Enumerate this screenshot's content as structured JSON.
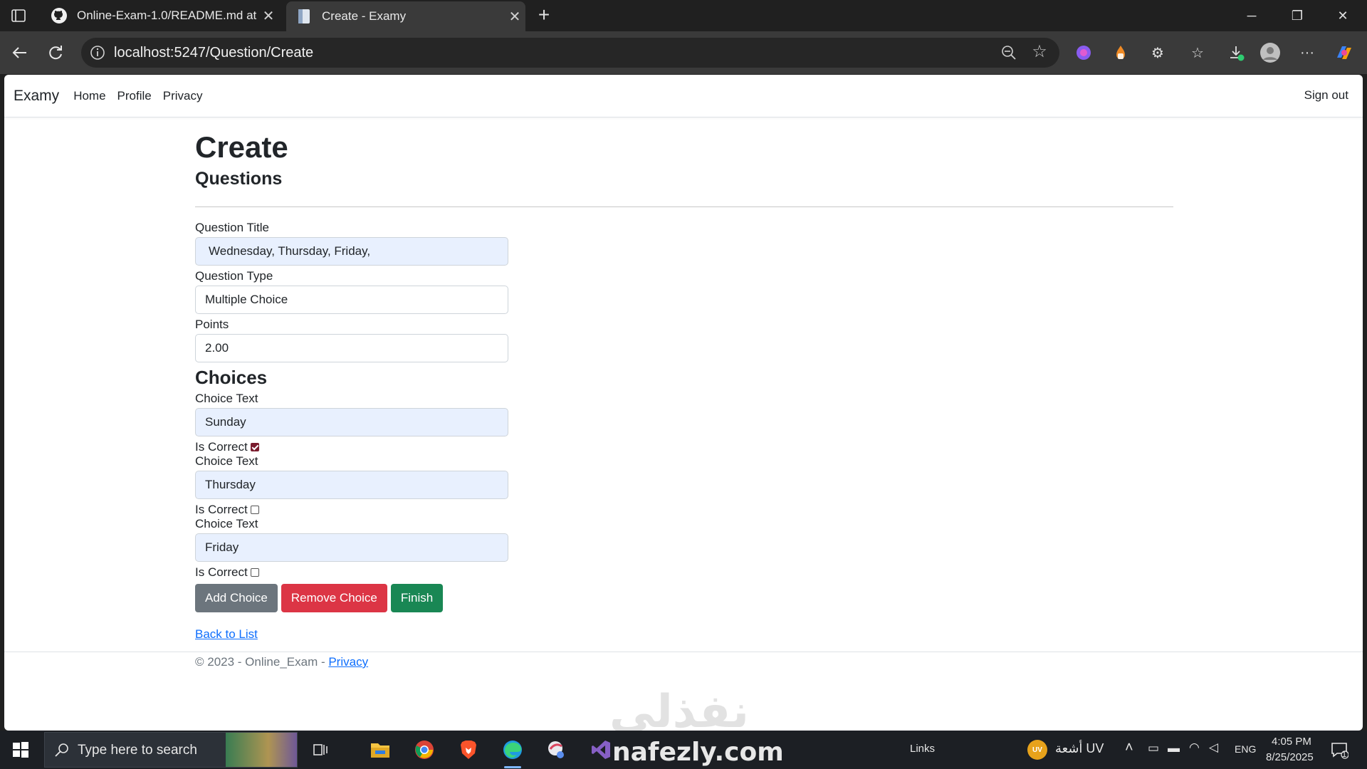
{
  "browser": {
    "tabs": [
      {
        "title": "Online-Exam-1.0/README.md at",
        "favicon": "github-icon"
      },
      {
        "title": "Create - Examy",
        "favicon": "page-icon"
      }
    ],
    "url": "localhost:5247/Question/Create"
  },
  "site": {
    "brand": "Examy",
    "nav": [
      "Home",
      "Profile",
      "Privacy"
    ],
    "signout": "Sign out"
  },
  "page": {
    "title": "Create",
    "subtitle": "Questions",
    "fields": {
      "title_label": "Question Title",
      "title_value": "Wednesday, Thursday, Friday,",
      "type_label": "Question Type",
      "type_value": "Multiple Choice",
      "points_label": "Points",
      "points_value": "2.00"
    },
    "choices_heading": "Choices",
    "choices": [
      {
        "label": "Choice Text",
        "value": "Sunday",
        "correct_label": "Is Correct",
        "correct": true
      },
      {
        "label": "Choice Text",
        "value": "Thursday",
        "correct_label": "Is Correct",
        "correct": false
      },
      {
        "label": "Choice Text",
        "value": "Friday",
        "correct_label": "Is Correct",
        "correct": false
      }
    ],
    "buttons": {
      "add": "Add Choice",
      "remove": "Remove Choice",
      "finish": "Finish"
    },
    "back_link": "Back to List"
  },
  "footer": {
    "text": "© 2023 - Online_Exam - ",
    "link": "Privacy"
  },
  "watermark": {
    "arabic": "نفذلي",
    "site": "nafezly.com"
  },
  "taskbar": {
    "search_placeholder": "Type here to search",
    "links": "Links",
    "weather": "أشعة UV",
    "weather_badge": "UV",
    "lang": "ENG",
    "time": "4:05 PM",
    "date": "8/25/2025",
    "notif_count": "1"
  },
  "colors": {
    "accent": "#0d6efd",
    "btn_gray": "#6c757d",
    "btn_red": "#dc3545",
    "btn_green": "#198754",
    "autofill": "#e8f0fe"
  }
}
